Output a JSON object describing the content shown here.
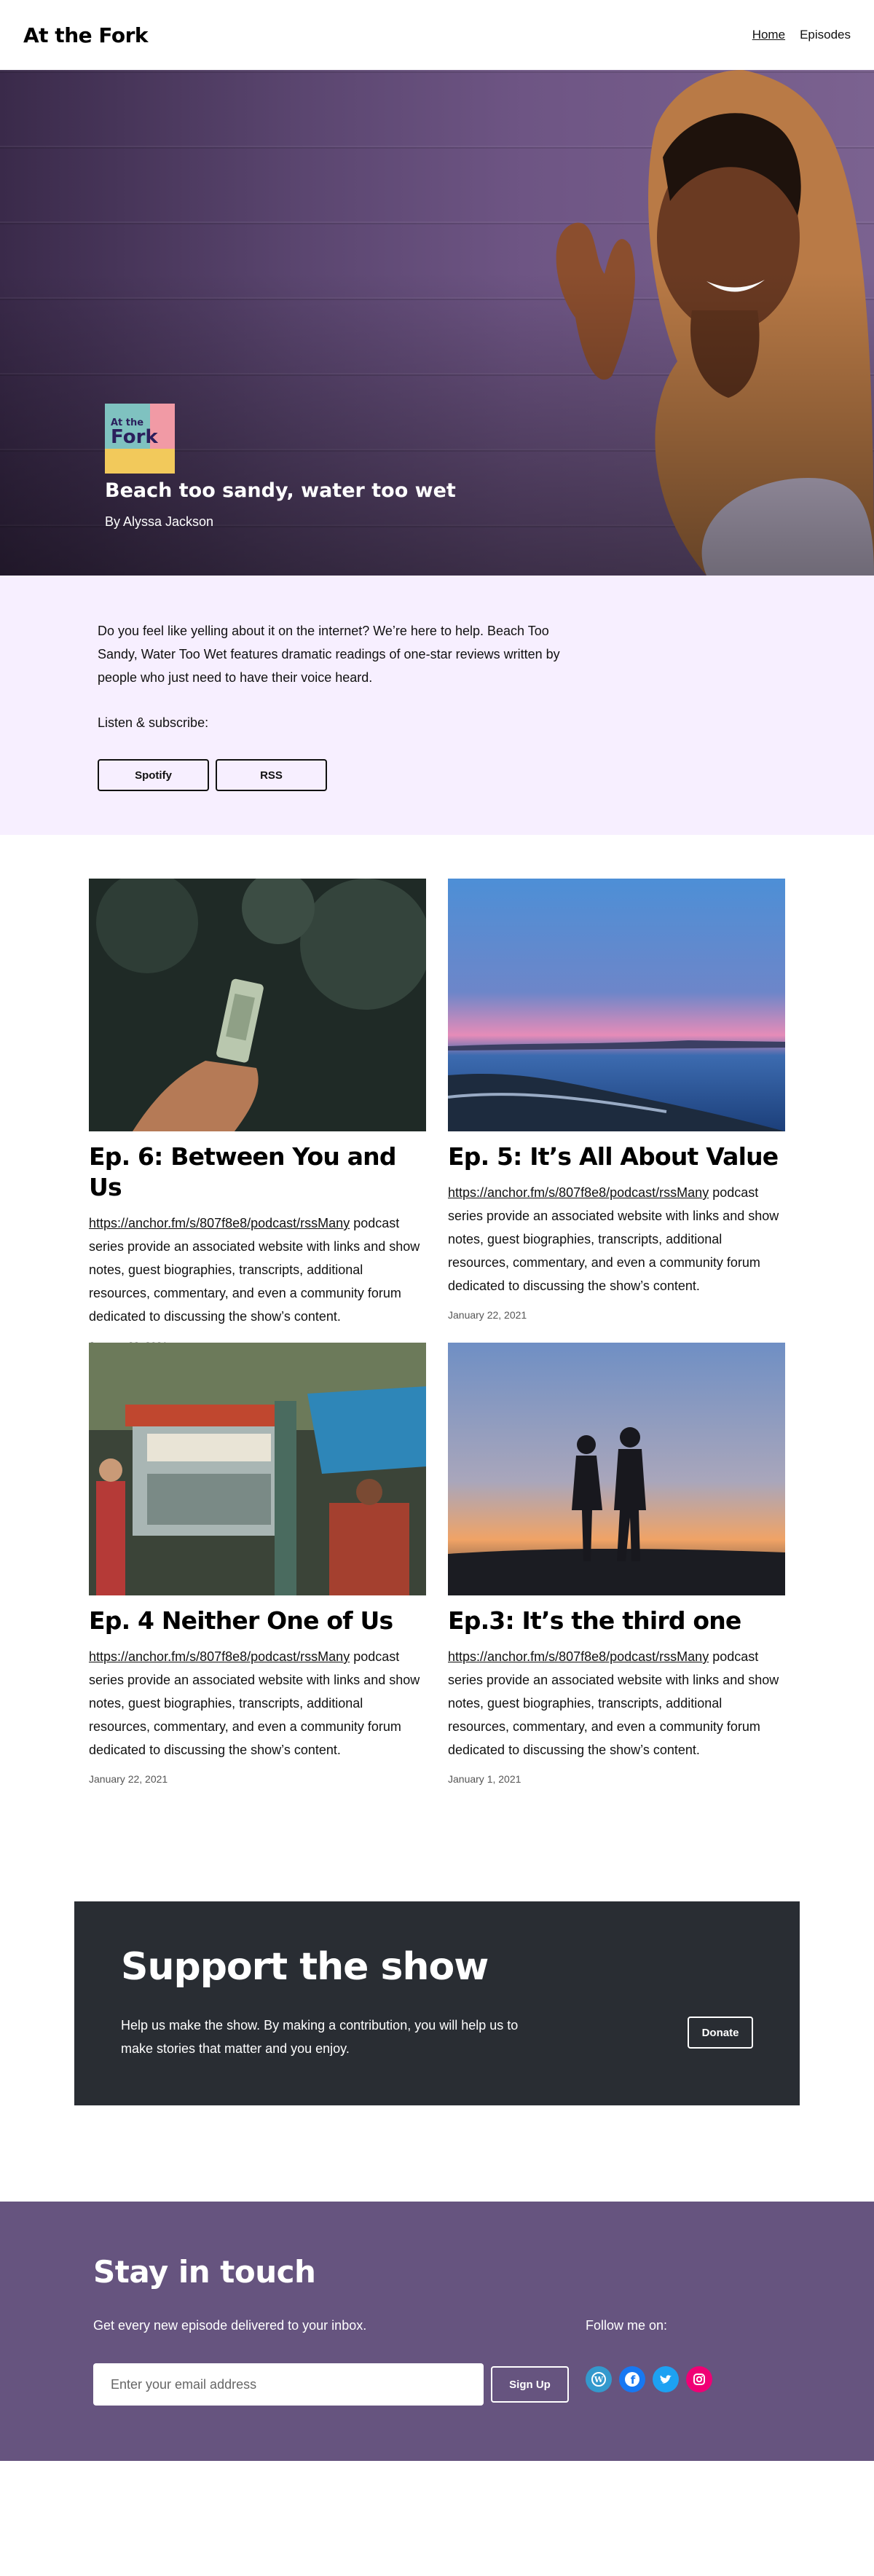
{
  "header": {
    "site_title": "At the Fork",
    "nav": [
      {
        "label": "Home"
      },
      {
        "label": "Episodes"
      }
    ]
  },
  "hero": {
    "cover_art": {
      "line1": "At the",
      "line2": "Fork"
    },
    "title": "Beach too sandy, water too wet",
    "author": "By Alyssa Jackson"
  },
  "intro": {
    "description": "Do you feel like yelling about it on the internet? We’re here to help. Beach Too Sandy, Water Too Wet features dramatic readings of one-star reviews written by people who just need to have their voice heard.",
    "listen_label": "Listen & subscribe:",
    "buttons": [
      {
        "label": "Spotify"
      },
      {
        "label": "RSS"
      }
    ]
  },
  "episodes": [
    {
      "title": "Ep. 6: Between You and Us",
      "link": "https://anchor.fm/s/807f8e8/podcast/rssMany",
      "body": " podcast series provide an associated website with links and show notes, guest biographies, transcripts, additional resources, commentary, and even a community forum dedicated to discussing the show’s content.",
      "date": "January 22, 2021"
    },
    {
      "title": "Ep. 5: It’s All About Value",
      "link": "https://anchor.fm/s/807f8e8/podcast/rssMany",
      "body": " podcast series provide an associated website with links and show notes, guest biographies, transcripts, additional resources, commentary, and even a community forum dedicated to discussing the show’s content.",
      "date": "January 22, 2021"
    },
    {
      "title": "Ep. 4 Neither One of Us",
      "link": "https://anchor.fm/s/807f8e8/podcast/rssMany",
      "body": " podcast series provide an associated website with links and show notes, guest biographies, transcripts, additional resources, commentary, and even a community forum dedicated to discussing the show’s content.",
      "date": "January 22, 2021"
    },
    {
      "title": "Ep.3: It’s the third one",
      "link": "https://anchor.fm/s/807f8e8/podcast/rssMany",
      "body": " podcast series provide an associated website with links and show notes, guest biographies, transcripts, additional resources, commentary, and even a community forum dedicated to discussing the show’s content.",
      "date": "January 1, 2021"
    }
  ],
  "support": {
    "title": "Support the show",
    "text": "Help us make the show. By making a contribution, you will help us to make stories that matter and you enjoy.",
    "donate_label": "Donate"
  },
  "footer": {
    "title": "Stay in touch",
    "subtitle": "Get every new episode delivered to your inbox.",
    "email_placeholder": "Enter your email address",
    "signup_label": "Sign Up",
    "follow_label": "Follow me on:",
    "socials": [
      {
        "icon": "wordpress-icon",
        "color": "#3499cd"
      },
      {
        "icon": "facebook-icon",
        "color": "#1778f2"
      },
      {
        "icon": "twitter-icon",
        "color": "#1da1f2"
      },
      {
        "icon": "instagram-icon",
        "color": "#f00075"
      }
    ]
  }
}
